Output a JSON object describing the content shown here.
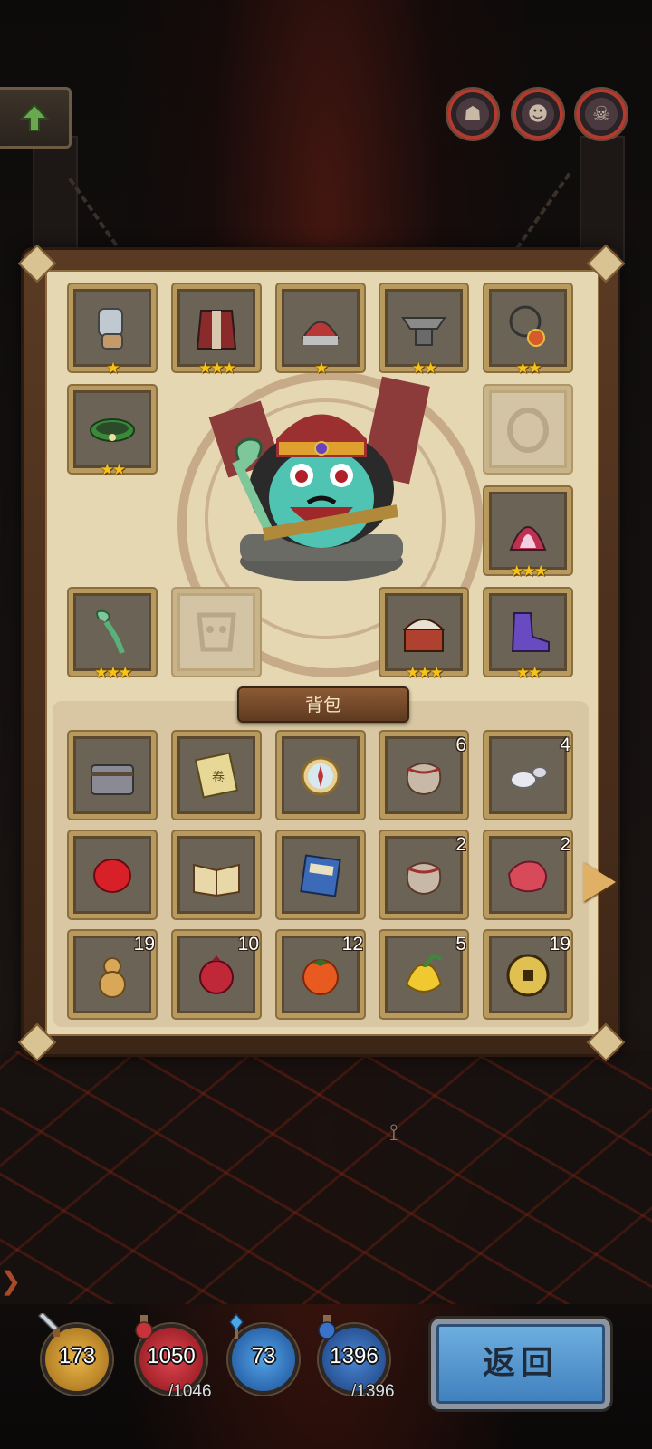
{
  "equipment": [
    {
      "name": "gauntlet-icon",
      "stars": "★",
      "empty": false
    },
    {
      "name": "armor-icon",
      "stars": "★★★",
      "empty": false
    },
    {
      "name": "helmet-icon",
      "stars": "★",
      "empty": false
    },
    {
      "name": "anvil-icon",
      "stars": "★★",
      "empty": false
    },
    {
      "name": "amulet-icon",
      "stars": "★★",
      "empty": false
    },
    {
      "name": "bracelet-icon",
      "stars": "★★",
      "empty": false
    },
    {
      "name": "ring-slot-icon",
      "stars": "",
      "empty": true
    },
    {
      "name": "cloak-icon",
      "stars": "★★★",
      "empty": false
    },
    {
      "name": "ruyi-scepter-icon",
      "stars": "★★★",
      "empty": false
    },
    {
      "name": "mask-slot-icon",
      "stars": "",
      "empty": true
    },
    {
      "name": "treasure-chest-icon",
      "stars": "★★★",
      "empty": false
    },
    {
      "name": "boots-icon",
      "stars": "★★",
      "empty": false
    }
  ],
  "bag": {
    "title": "背包",
    "items": [
      {
        "name": "iron-chest-icon",
        "count": ""
      },
      {
        "name": "scroll-map-icon",
        "count": ""
      },
      {
        "name": "compass-icon",
        "count": ""
      },
      {
        "name": "pouch-icon",
        "count": "6"
      },
      {
        "name": "silver-pieces-icon",
        "count": "4"
      },
      {
        "name": "red-gem-icon",
        "count": ""
      },
      {
        "name": "open-book-icon",
        "count": ""
      },
      {
        "name": "manual-book-icon",
        "count": ""
      },
      {
        "name": "pouch-icon",
        "count": "2"
      },
      {
        "name": "raw-meat-icon",
        "count": "2"
      },
      {
        "name": "gourd-icon",
        "count": "19"
      },
      {
        "name": "pomegranate-icon",
        "count": "10"
      },
      {
        "name": "persimmon-icon",
        "count": "12"
      },
      {
        "name": "buddha-hand-fruit-icon",
        "count": "5"
      },
      {
        "name": "coin-icon",
        "count": "19"
      }
    ]
  },
  "stats": {
    "attack": {
      "value": "173"
    },
    "hp": {
      "value": "1050",
      "max": "/1046"
    },
    "defense": {
      "value": "73"
    },
    "mp": {
      "value": "1396",
      "max": "/1396"
    }
  },
  "back_label": "返回",
  "colors": {
    "star": "#f6c21c",
    "hp": "#b8232a",
    "mp": "#2f6fc4",
    "attack": "#d29a2a",
    "button": "#4d8fcf"
  }
}
